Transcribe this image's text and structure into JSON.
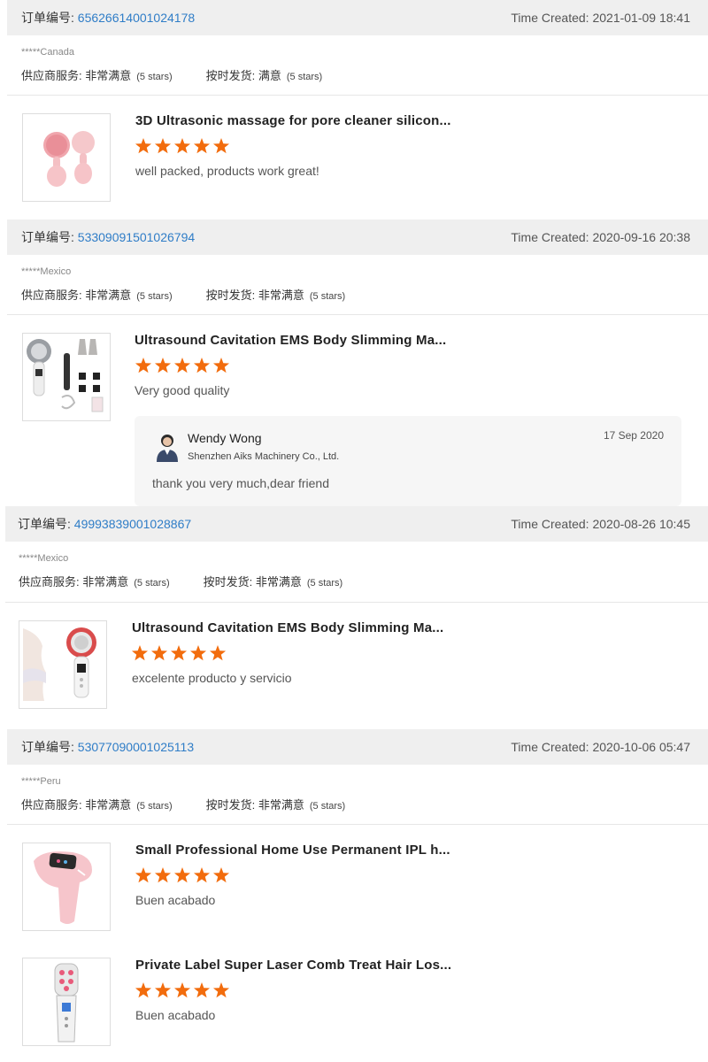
{
  "orders": [
    {
      "label": "订单编号:",
      "number": "65626614001024178",
      "time_created": "Time Created: 2021-01-09 18:41",
      "buyer": "*****Canada",
      "supplier_service_label": "供应商服务:",
      "supplier_service_value": "非常满意",
      "supplier_service_stars": "(5 stars)",
      "on_time_label": "按时发货:",
      "on_time_value": "满意",
      "on_time_stars": "(5 stars)",
      "products": [
        {
          "title": "3D Ultrasonic massage for pore cleaner silicon...",
          "rating": 5,
          "comment": "well packed, products  work great!"
        }
      ]
    },
    {
      "label": "订单编号:",
      "number": "53309091501026794",
      "time_created": "Time Created: 2020-09-16 20:38",
      "buyer": "*****Mexico",
      "supplier_service_label": "供应商服务:",
      "supplier_service_value": "非常满意",
      "supplier_service_stars": "(5 stars)",
      "on_time_label": "按时发货:",
      "on_time_value": "非常满意",
      "on_time_stars": "(5 stars)",
      "products": [
        {
          "title": "Ultrasound Cavitation EMS Body Slimming Ma...",
          "rating": 5,
          "comment": "Very good quality"
        }
      ],
      "reply": {
        "name": "Wendy Wong",
        "company": "Shenzhen Aiks Machinery Co., Ltd.",
        "date": "17 Sep 2020",
        "text": "thank you very much,dear friend"
      }
    },
    {
      "label": "订单编号:",
      "number": "49993839001028867",
      "time_created": "Time Created: 2020-08-26 10:45",
      "buyer": "*****Mexico",
      "supplier_service_label": "供应商服务:",
      "supplier_service_value": "非常满意",
      "supplier_service_stars": "(5 stars)",
      "on_time_label": "按时发货:",
      "on_time_value": "非常满意",
      "on_time_stars": "(5 stars)",
      "products": [
        {
          "title": "Ultrasound Cavitation EMS Body Slimming Ma...",
          "rating": 5,
          "comment": "excelente producto y servicio"
        }
      ]
    },
    {
      "label": "订单编号:",
      "number": "53077090001025113",
      "time_created": "Time Created: 2020-10-06 05:47",
      "buyer": "*****Peru",
      "supplier_service_label": "供应商服务:",
      "supplier_service_value": "非常满意",
      "supplier_service_stars": "(5 stars)",
      "on_time_label": "按时发货:",
      "on_time_value": "非常满意",
      "on_time_stars": "(5 stars)",
      "products": [
        {
          "title": "Small Professional Home Use Permanent IPL h...",
          "rating": 5,
          "comment": "Buen acabado"
        },
        {
          "title": "Private Label Super Laser Comb Treat Hair Los...",
          "rating": 5,
          "comment": "Buen acabado"
        }
      ]
    }
  ],
  "colors": {
    "star": "#f26c0d",
    "link": "#2f7dc7",
    "header_bg": "#efefef"
  }
}
